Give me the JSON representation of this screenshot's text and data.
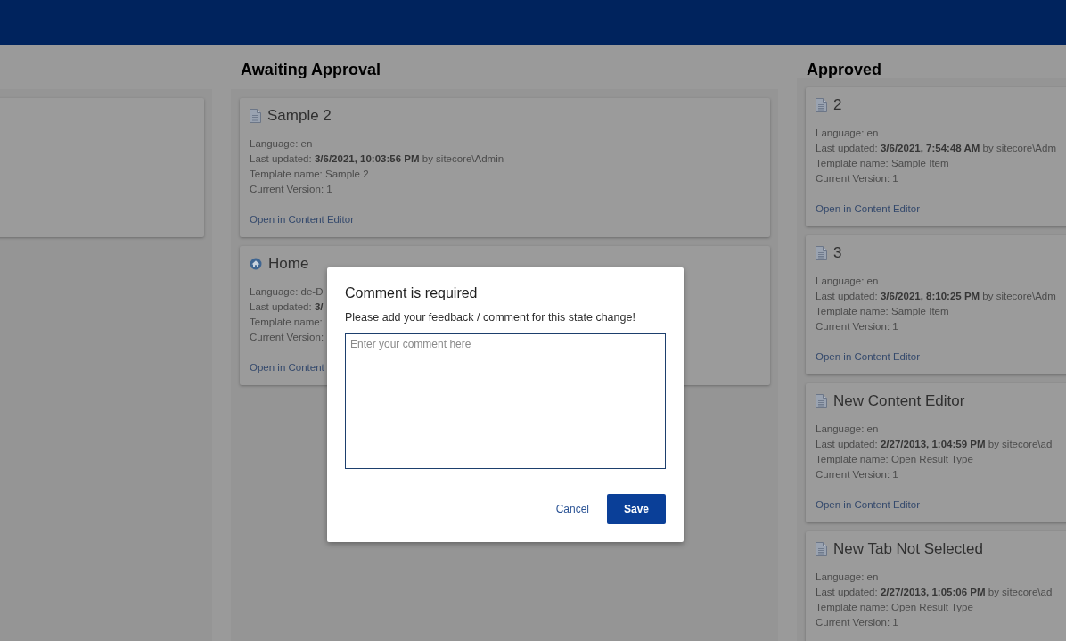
{
  "columns": [
    {
      "title": "Awaiting Approval",
      "cards": [
        {
          "kind": "item",
          "title": "Sample 2",
          "language": "Language: en",
          "last_updated": "Last updated: **3/6/2021, 10:03:56 PM** by sitecore\\Admin",
          "template_name": "Template name: Sample 2",
          "version": "Current Version: 1",
          "link": "Open in Content Editor"
        },
        {
          "kind": "home",
          "title": "Home",
          "language": "Language: de-D",
          "last_updated": "Last updated: **3/**",
          "template_name": "Template name:",
          "version": "Current Version:",
          "link": "Open in Content"
        }
      ]
    },
    {
      "title": "Approved",
      "cards": [
        {
          "kind": "item",
          "title": "2",
          "language": "Language: en",
          "last_updated": "Last updated: **3/6/2021, 7:54:48 AM** by sitecore\\Adm",
          "template_name": "Template name: Sample Item",
          "version": "Current Version: 1",
          "link": "Open in Content Editor"
        },
        {
          "kind": "item",
          "title": "3",
          "language": "Language: en",
          "last_updated": "Last updated: **3/6/2021, 8:10:25 PM** by sitecore\\Adm",
          "template_name": "Template name: Sample Item",
          "version": "Current Version: 1",
          "link": "Open in Content Editor"
        },
        {
          "kind": "item",
          "title": "New Content Editor",
          "language": "Language: en",
          "last_updated": "Last updated: **2/27/2013, 1:04:59 PM** by sitecore\\ad",
          "template_name": "Template name: Open Result Type",
          "version": "Current Version: 1",
          "link": "Open in Content Editor"
        },
        {
          "kind": "item",
          "title": "New Tab Not Selected",
          "language": "Language: en",
          "last_updated": "Last updated: **2/27/2013, 1:05:06 PM** by sitecore\\ad",
          "template_name": "Template name: Open Result Type",
          "version": "Current Version: 1"
        }
      ]
    }
  ],
  "dialog": {
    "title": "Comment is required",
    "message": "Please add your feedback / comment for this state change!",
    "comment": {
      "placeholder": "Enter your comment here"
    },
    "buttons": [
      {
        "kind": "link",
        "label": "Cancel"
      },
      {
        "kind": "primary",
        "label": "Save"
      }
    ]
  }
}
